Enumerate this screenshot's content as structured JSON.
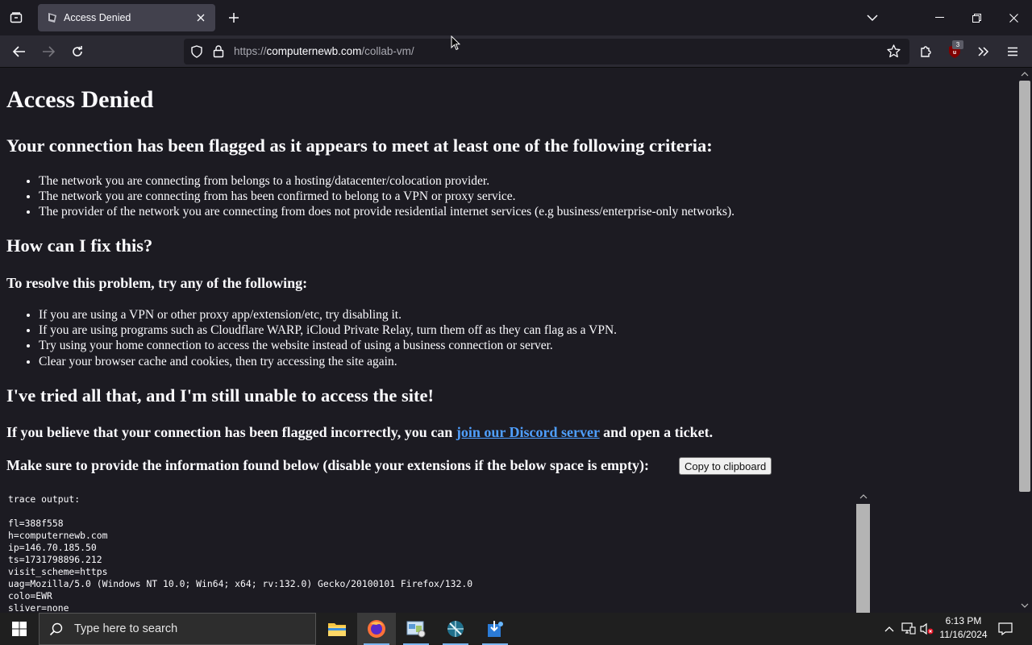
{
  "browser": {
    "tab_title": "Access Denied",
    "url_host": "https://computernewb.com",
    "url_host_prefix": "https://",
    "url_host_name": "computernewb.com",
    "url_path": "/collab-vm/",
    "extension_badge": "3"
  },
  "page": {
    "title": "Access Denied",
    "flagged_heading": "Your connection has been flagged as it appears to meet at least one of the following criteria:",
    "criteria": [
      "The network you are connecting from belongs to a hosting/datacenter/colocation provider.",
      "The network you are connecting from has been confirmed to belong to a VPN or proxy service.",
      "The provider of the network you are connecting from does not provide residential internet services (e.g business/enterprise-only networks)."
    ],
    "fix_heading": "How can I fix this?",
    "resolve_heading": "To resolve this problem, try any of the following:",
    "fixes": [
      "If you are using a VPN or other proxy app/extension/etc, try disabling it.",
      "If you are using programs such as Cloudflare WARP, iCloud Private Relay, turn them off as they can flag as a VPN.",
      "Try using your home connection to access the website instead of using a business connection or server.",
      "Clear your browser cache and cookies, then try accessing the site again."
    ],
    "tried_heading": "I've tried all that, and I'm still unable to access the site!",
    "incorrect_prefix": "If you believe that your connection has been flagged incorrectly, you can ",
    "discord_link": "join our Discord server",
    "incorrect_suffix": " and open a ticket.",
    "provide_info": "Make sure to provide the information found below (disable your extensions if the below space is empty):",
    "copy_button": "Copy to clipboard",
    "trace_lines": [
      "trace output:",
      "",
      "fl=388f558",
      "h=computernewb.com",
      "ip=146.70.185.50",
      "ts=1731798896.212",
      "visit_scheme=https",
      "uag=Mozilla/5.0 (Windows NT 10.0; Win64; x64; rv:132.0) Gecko/20100101 Firefox/132.0",
      "colo=EWR",
      "sliver=none"
    ]
  },
  "taskbar": {
    "search_placeholder": "Type here to search",
    "time": "6:13 PM",
    "date": "11/16/2024",
    "apps": [
      "file-explorer",
      "firefox",
      "control-panel",
      "network-app",
      "app-installer"
    ]
  },
  "colors": {
    "page_bg": "#1c1b22",
    "link": "#4f9fff",
    "toolbar": "#2b2a33",
    "tab_active": "#42414d"
  }
}
